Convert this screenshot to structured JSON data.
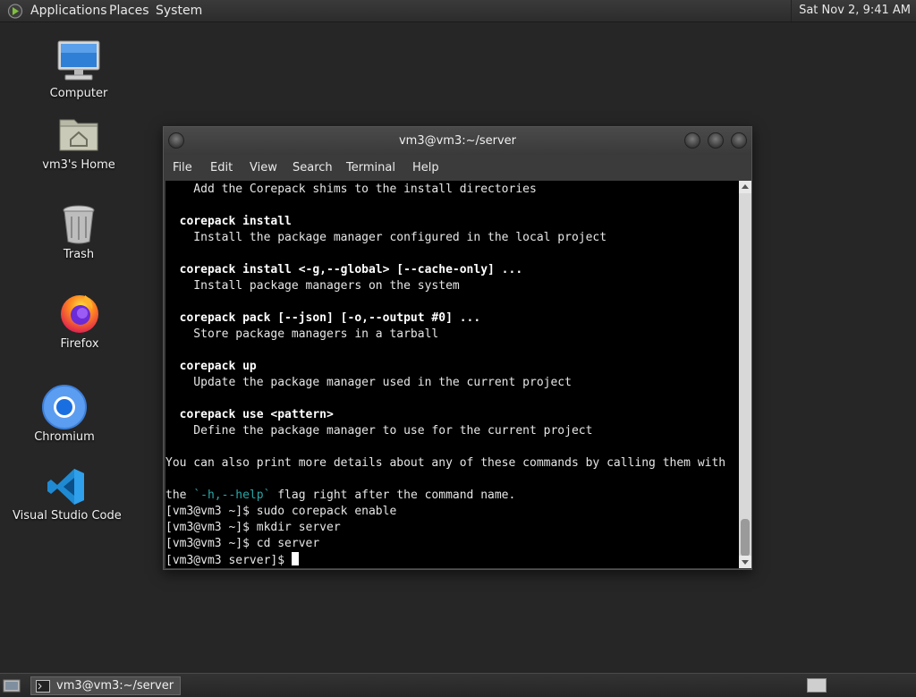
{
  "top_panel": {
    "menus": [
      "Applications",
      "Places",
      "System"
    ],
    "clock": "Sat Nov 2, 9:41 AM"
  },
  "desktop_icons": [
    {
      "label": "Computer",
      "icon": "computer-icon"
    },
    {
      "label": "vm3's Home",
      "icon": "home-folder-icon"
    },
    {
      "label": "Trash",
      "icon": "trash-icon"
    },
    {
      "label": "Firefox",
      "icon": "firefox-icon"
    },
    {
      "label": "Chromium",
      "icon": "chromium-icon"
    },
    {
      "label": "Visual Studio Code",
      "icon": "vscode-icon"
    }
  ],
  "window": {
    "title": "vm3@vm3:~/server",
    "menus": [
      "File",
      "Edit",
      "View",
      "Search",
      "Terminal",
      "Help"
    ]
  },
  "terminal": {
    "lines": [
      {
        "text": "    Add the Corepack shims to the install directories",
        "style": "normal"
      },
      {
        "text": "",
        "style": "normal"
      },
      {
        "text": "  corepack install",
        "style": "bold"
      },
      {
        "text": "    Install the package manager configured in the local project",
        "style": "normal"
      },
      {
        "text": "",
        "style": "normal"
      },
      {
        "text": "  corepack install <-g,--global> [--cache-only] ...",
        "style": "bold"
      },
      {
        "text": "    Install package managers on the system",
        "style": "normal"
      },
      {
        "text": "",
        "style": "normal"
      },
      {
        "text": "  corepack pack [--json] [-o,--output #0] ...",
        "style": "bold"
      },
      {
        "text": "    Store package managers in a tarball",
        "style": "normal"
      },
      {
        "text": "",
        "style": "normal"
      },
      {
        "text": "  corepack up",
        "style": "bold"
      },
      {
        "text": "    Update the package manager used in the current project",
        "style": "normal"
      },
      {
        "text": "",
        "style": "normal"
      },
      {
        "text": "  corepack use <pattern>",
        "style": "bold"
      },
      {
        "text": "    Define the package manager to use for the current project",
        "style": "normal"
      },
      {
        "text": "",
        "style": "normal"
      },
      {
        "text": "You can also print more details about any of these commands by calling them with",
        "style": "normal"
      },
      {
        "text": "",
        "style": "normal"
      },
      {
        "segments": [
          {
            "text": "the ",
            "style": "normal"
          },
          {
            "text": "`-h,--help`",
            "style": "cyan"
          },
          {
            "text": " flag right after the command name.",
            "style": "normal"
          }
        ]
      },
      {
        "text": "[vm3@vm3 ~]$ sudo corepack enable",
        "style": "normal"
      },
      {
        "text": "[vm3@vm3 ~]$ mkdir server",
        "style": "normal"
      },
      {
        "text": "[vm3@vm3 ~]$ cd server",
        "style": "normal"
      },
      {
        "text": "[vm3@vm3 server]$",
        "style": "prompt"
      }
    ]
  },
  "taskbar": {
    "item_label": "vm3@vm3:~/server"
  },
  "colors": {
    "terminal_bg": "#000000",
    "desktop_bg": "#262626",
    "help_flag": "#2aa6a6"
  }
}
